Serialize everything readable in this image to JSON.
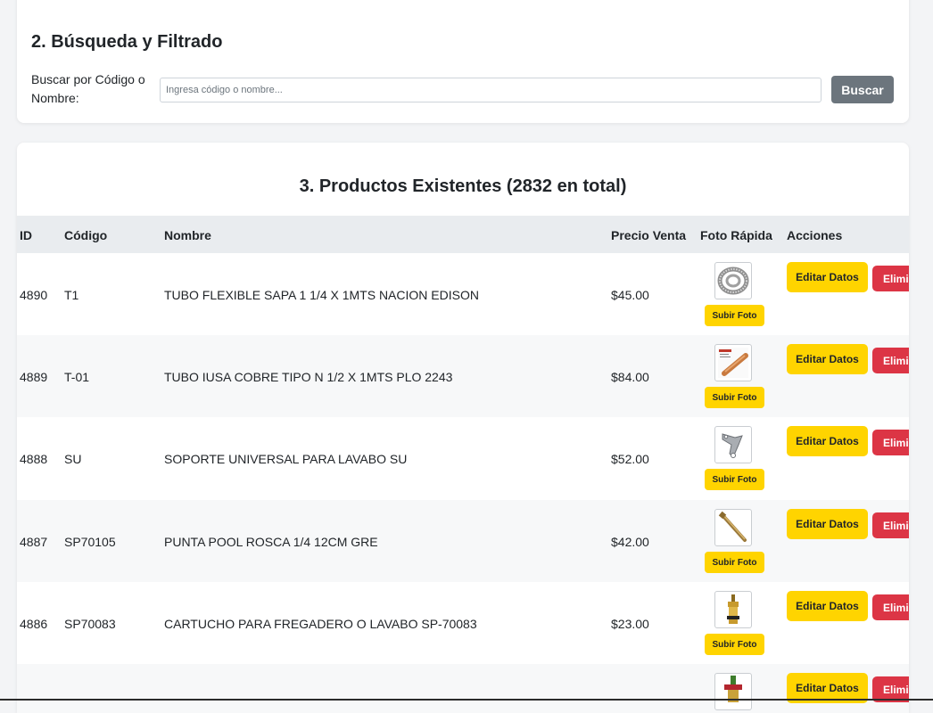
{
  "search": {
    "title": "2. Búsqueda y Filtrado",
    "label": "Buscar por Código o Nombre:",
    "placeholder": "Ingresa código o nombre...",
    "value": "",
    "button_label": "Buscar"
  },
  "products": {
    "title": "3. Productos Existentes (2832 en total)",
    "columns": [
      "ID",
      "Código",
      "Nombre",
      "Precio Venta",
      "Foto Rápida",
      "Acciones"
    ],
    "upload_label": "Subir Foto",
    "edit_label": "Editar Datos",
    "delete_label": "Eliminar",
    "rows": [
      {
        "id": "4890",
        "code": "T1",
        "name": "TUBO FLEXIBLE SAPA 1 1/4 X 1MTS NACION EDISON",
        "price": "$45.00",
        "photo": "flexible-hose-photo"
      },
      {
        "id": "4889",
        "code": "T-01",
        "name": "TUBO IUSA COBRE TIPO N 1/2 X 1MTS PLO 2243",
        "price": "$84.00",
        "photo": "copper-pipe-photo"
      },
      {
        "id": "4888",
        "code": "SU",
        "name": "SOPORTE UNIVERSAL PARA LAVABO SU",
        "price": "$52.00",
        "photo": "sink-bracket-photo"
      },
      {
        "id": "4887",
        "code": "SP70105",
        "name": "PUNTA POOL ROSCA 1/4 12CM GRE",
        "price": "$42.00",
        "photo": "brass-rod-photo"
      },
      {
        "id": "4886",
        "code": "SP70083",
        "name": "CARTUCHO PARA FREGADERO O LAVABO SP-70083",
        "price": "$23.00",
        "photo": "cartridge-photo"
      },
      {
        "id": "",
        "code": "",
        "name": "",
        "price": "",
        "photo": "valve-photo"
      }
    ]
  }
}
